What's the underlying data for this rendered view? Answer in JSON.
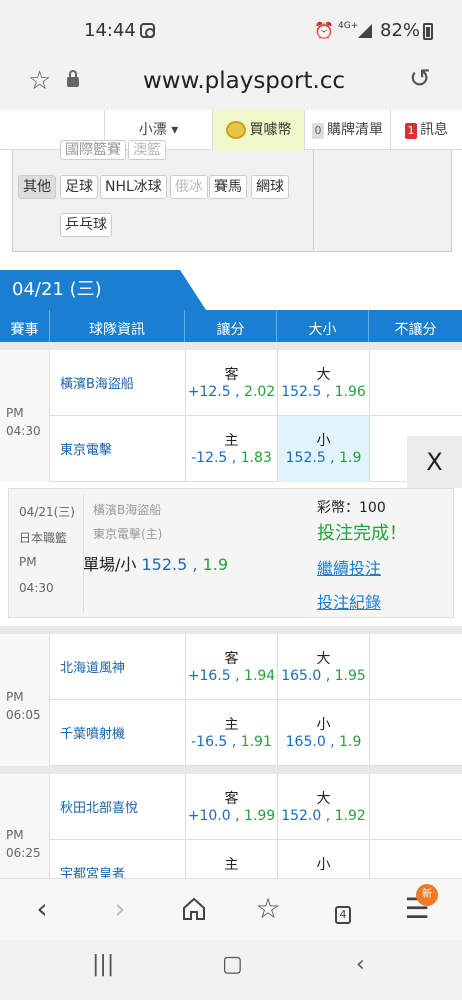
{
  "status": {
    "time": "14:44",
    "network": "4G+",
    "battery": "82%"
  },
  "browser": {
    "url": "www.playsport.cc",
    "tab_count": "4",
    "menu_badge": "新"
  },
  "topmenu": {
    "lottery": "小漂 ▾",
    "buy_coins": "買噱幣",
    "cart_count": "0",
    "cart": "購牌清單",
    "msg_count": "1",
    "messages": "訊息"
  },
  "categories": {
    "cut_row": [
      "國際籃賽",
      "澳籃"
    ],
    "label": "其他",
    "items": [
      "足球",
      "NHL冰球",
      "俄冰",
      "賽馬",
      "網球",
      "乒乓球"
    ]
  },
  "date": "04/21 (三)",
  "table_header": {
    "event": "賽事",
    "teams": "球隊資訊",
    "spread": "讓分",
    "total": "大小",
    "no_spread": "不讓分"
  },
  "games": [
    {
      "ampm": "PM",
      "time": "04:30",
      "rows": [
        {
          "team": "橫濱B海盜船",
          "spread_side": "客",
          "spread_line": "+12.5",
          "spread_odds": "2.02",
          "total_side": "大",
          "total_line": "152.5",
          "total_odds": "1.96"
        },
        {
          "team": "東京電擊",
          "spread_side": "主",
          "spread_line": "-12.5",
          "spread_odds": "1.83",
          "total_side": "小",
          "total_line": "152.5",
          "total_odds": "1.9"
        }
      ]
    },
    {
      "ampm": "PM",
      "time": "06:05",
      "rows": [
        {
          "team": "北海道風神",
          "spread_side": "客",
          "spread_line": "+16.5",
          "spread_odds": "1.94",
          "total_side": "大",
          "total_line": "165.0",
          "total_odds": "1.95"
        },
        {
          "team": "千葉噴射機",
          "spread_side": "主",
          "spread_line": "-16.5",
          "spread_odds": "1.91",
          "total_side": "小",
          "total_line": "165.0",
          "total_odds": "1.9"
        }
      ]
    },
    {
      "ampm": "PM",
      "time": "06:25",
      "rows": [
        {
          "team": "秋田北部喜悅",
          "spread_side": "客",
          "spread_line": "+10.0",
          "spread_odds": "1.99",
          "total_side": "大",
          "total_line": "152.0",
          "total_odds": "1.92"
        },
        {
          "team": "宇都宮皇者",
          "spread_side": "主",
          "spread_line": "",
          "spread_odds": "",
          "total_side": "小",
          "total_line": "",
          "total_odds": ""
        }
      ]
    }
  ],
  "popup": {
    "close": "X",
    "date": "04/21(三)",
    "league": "日本職籃",
    "ampm": "PM",
    "time": "04:30",
    "away": "橫濱B海盜船",
    "home": "東京電擊(主)",
    "bet_label": "單場/小",
    "bet_line": "152.5",
    "bet_odds": "1.9",
    "coins": "彩幣：100",
    "done": "投注完成！",
    "continue": "繼續投注",
    "records": "投注紀錄"
  }
}
